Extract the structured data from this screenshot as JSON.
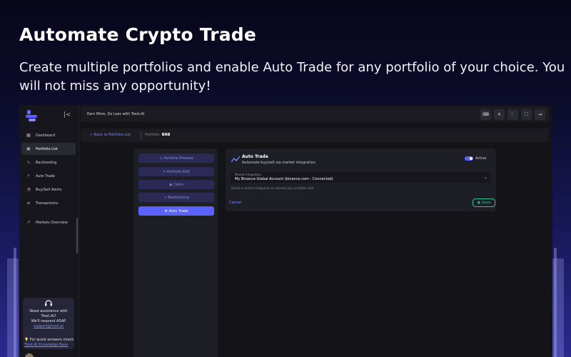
{
  "hero": {
    "title": "Automate Crypto Trade",
    "subtitle": "Create multiple portfolios and enable Auto Trade for any portfolio of your choice. You will not miss any opportunity!"
  },
  "topbar": {
    "tagline": "Earn More, Do Less with Trest.AI"
  },
  "sidebar": {
    "items": [
      {
        "label": "Dashboard",
        "icon": "grid-icon"
      },
      {
        "label": "Portfolio List",
        "icon": "portfolio-icon"
      },
      {
        "label": "Backtesting",
        "icon": "chart-line-icon"
      },
      {
        "label": "Auto Trade",
        "icon": "auto-trade-icon"
      },
      {
        "label": "Buy/Sell Alerts",
        "icon": "alert-icon"
      },
      {
        "label": "Transactions",
        "icon": "list-icon"
      },
      {
        "label": "Markets Overview",
        "icon": "markets-icon"
      }
    ],
    "help": {
      "line1": "Need assistance with",
      "line2": "Trest.AI?",
      "line3": "We'll respond ASAP",
      "email": "support@trest.ai",
      "quick": "For quick answers check",
      "kb": "Trest.AI Knowledge Base"
    }
  },
  "breadcrumb": {
    "back": "Back to Portfolio List",
    "label": "Portfolio",
    "value": "BNB"
  },
  "tabs": [
    "Portfolio Preview",
    "Portfolio Edit",
    "Coins",
    "Backtesting",
    "Auto Trade"
  ],
  "autotrade": {
    "title": "Auto Trade",
    "subtitle": "Automate buy/sell via market integration",
    "toggle_label": "Active",
    "integration_label": "Market Integration",
    "integration_value": "My Binance Global Account (binance.com - Connected)",
    "hint": "Select a market integration to connect your portfolio with",
    "cancel": "Cancel",
    "save": "Save"
  },
  "colors": {
    "accent": "#5a63ff",
    "success": "#2fbf8f"
  }
}
